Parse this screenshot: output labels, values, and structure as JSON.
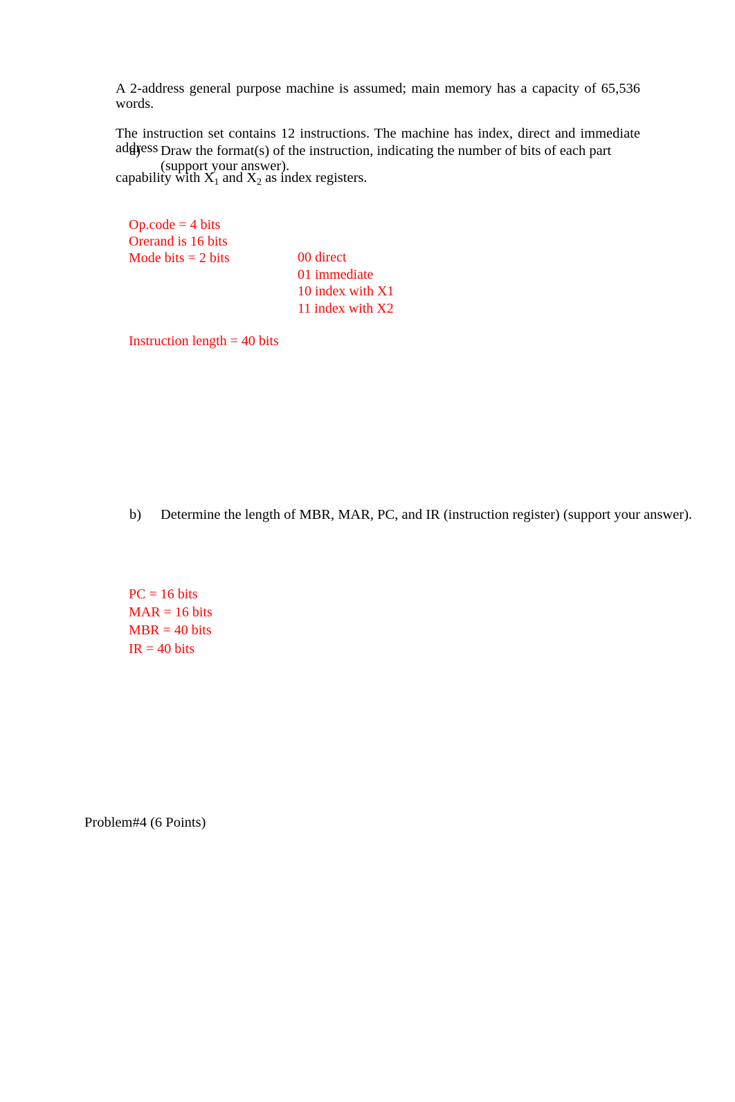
{
  "document": {
    "intro_paragraph": {
      "line1": "A 2-address general purpose machine is assumed; main memory has a capacity of 65,536 words.",
      "line2": "The instruction set contains 12 instructions.  The machine has index, direct and immediate address",
      "line3_before_x1": "capability with X",
      "x1_sub": "1",
      "line3_mid": " and X",
      "x2_sub": "2",
      "line3_after": " as index registers.",
      "full_text": "A 2-address general purpose machine is assumed; main memory has a capacity of 65,536 words. The instruction set contains 12 instructions.  The machine has index, direct and immediate address capability with X1 and X2 as index registers."
    },
    "questions": [
      {
        "marker": "a)",
        "text": "Draw the format(s) of the instruction, indicating the number of bits of each part (support your answer)."
      },
      {
        "marker": "b)",
        "text": "Determine the length of MBR, MAR, PC, and IR (instruction register) (support your answer)."
      }
    ],
    "answers": {
      "color": "#ff0000",
      "format_fields": [
        "Op.code = 4 bits",
        "Orerand is 16 bits",
        "Mode bits = 2 bits"
      ],
      "mode_table": [
        "00 direct",
        "01 immediate",
        "10 index with X1",
        "11 index with X2"
      ],
      "instruction_length": "Instruction length = 40 bits",
      "registers": [
        "PC = 16 bits",
        "MAR = 16 bits",
        "MBR = 40 bits",
        "IR = 40 bits"
      ]
    },
    "problem_heading": "Problem#4 (6 Points)"
  }
}
